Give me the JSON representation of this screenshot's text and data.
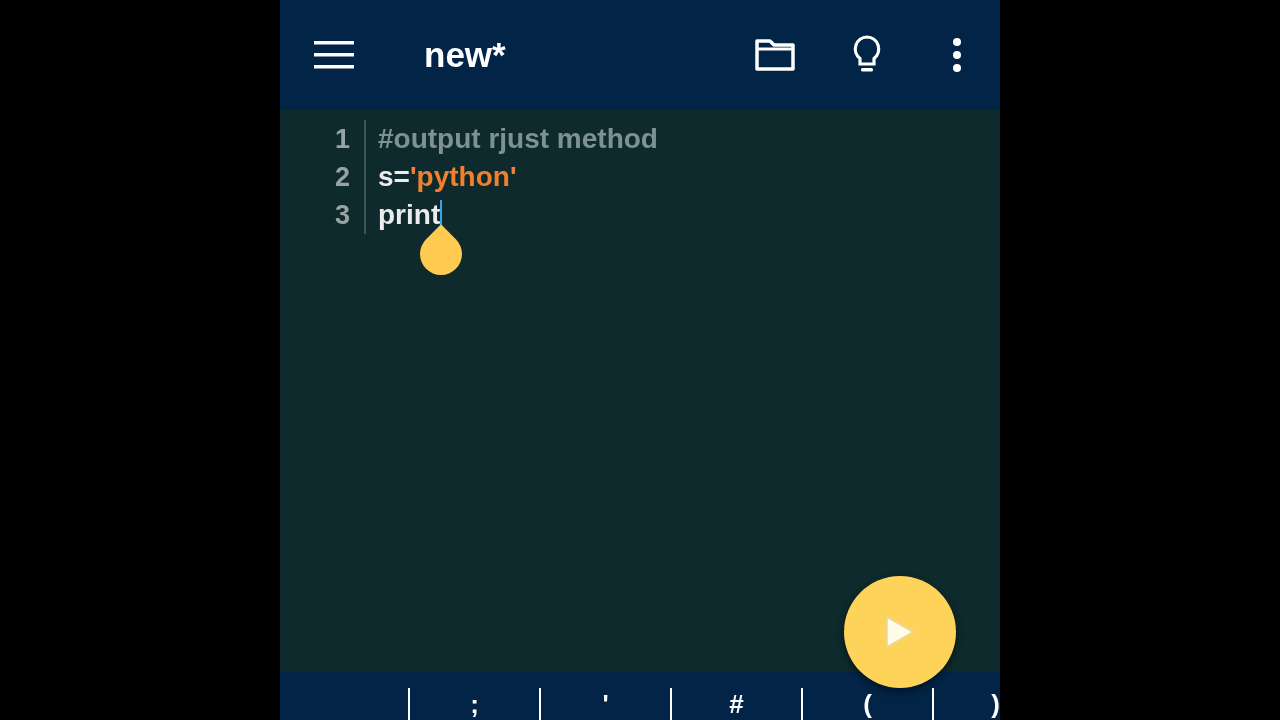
{
  "toolbar": {
    "title": "new*"
  },
  "code_lines": [
    {
      "number": "1",
      "tokens": [
        {
          "text": "#output rjust method",
          "kind": "comment"
        }
      ]
    },
    {
      "number": "2",
      "tokens": [
        {
          "text": "s=",
          "kind": "plain"
        },
        {
          "text": "'python'",
          "kind": "string"
        }
      ]
    },
    {
      "number": "3",
      "tokens": [
        {
          "text": "print",
          "kind": "plain"
        }
      ],
      "cursor": true
    }
  ],
  "symbol_keys": [
    ";",
    "'",
    "#",
    "(",
    ")"
  ]
}
